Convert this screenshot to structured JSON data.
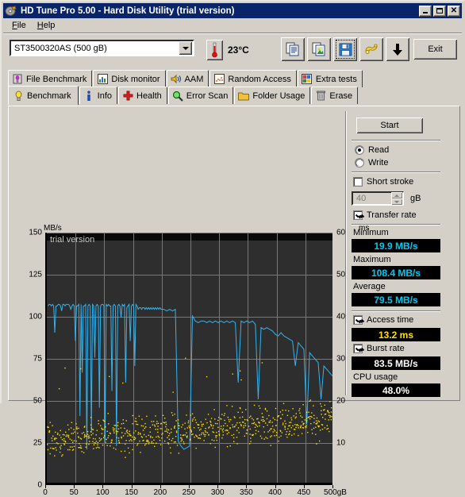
{
  "window": {
    "title": "HD Tune Pro 5.00 - Hard Disk Utility (trial version)",
    "icon": "hdtune-app-icon",
    "minimize_label": "_",
    "maximize_label": "□",
    "close_label": "✕"
  },
  "menu": {
    "items": [
      {
        "label": "File",
        "accel": "F"
      },
      {
        "label": "Help",
        "accel": "H"
      }
    ]
  },
  "toolbar": {
    "drive_selected": "ST3500320AS (500 gB)",
    "temperature": "23°C",
    "thermometer_icon": "thermometer-icon",
    "buttons": [
      {
        "name": "copy-text-button",
        "icon": "copy-text-icon"
      },
      {
        "name": "copy-image-button",
        "icon": "copy-image-icon"
      },
      {
        "name": "save-button",
        "icon": "floppy-save-icon",
        "focused": true
      },
      {
        "name": "options-button",
        "icon": "gear-options-icon"
      },
      {
        "name": "download-button",
        "icon": "arrow-down-icon"
      }
    ],
    "exit_label": "Exit"
  },
  "tabs": {
    "row1": [
      {
        "label": "File Benchmark",
        "icon": "bulb-purple-icon",
        "active": false
      },
      {
        "label": "Disk monitor",
        "icon": "bar-chart-icon",
        "active": false
      },
      {
        "label": "AAM",
        "icon": "speaker-icon",
        "active": false
      },
      {
        "label": "Random Access",
        "icon": "scatter-icon",
        "active": false
      },
      {
        "label": "Extra tests",
        "icon": "grid-chart-icon",
        "active": false
      }
    ],
    "row2": [
      {
        "label": "Benchmark",
        "icon": "bulb-yellow-icon",
        "active": true
      },
      {
        "label": "Info",
        "icon": "info-icon",
        "active": false
      },
      {
        "label": "Health",
        "icon": "red-cross-icon",
        "active": false
      },
      {
        "label": "Error Scan",
        "icon": "magnifier-icon",
        "active": false
      },
      {
        "label": "Folder Usage",
        "icon": "folder-icon",
        "active": false
      },
      {
        "label": "Erase",
        "icon": "trash-icon",
        "active": false
      }
    ]
  },
  "results": {
    "start_label": "Start",
    "mode_read": "Read",
    "mode_write": "Write",
    "mode_selected": "Read",
    "short_stroke_label": "Short stroke",
    "short_stroke_checked": false,
    "short_stroke_value": "40",
    "short_stroke_unit": "gB",
    "transfer_rate_label": "Transfer rate",
    "transfer_rate_checked": true,
    "minimum_label": "Minimum",
    "minimum_value": "19.9 MB/s",
    "maximum_label": "Maximum",
    "maximum_value": "108.4 MB/s",
    "average_label": "Average",
    "average_value": "79.5 MB/s",
    "access_time_label": "Access time",
    "access_time_checked": true,
    "access_time_value": "13.2 ms",
    "burst_rate_label": "Burst rate",
    "burst_rate_checked": true,
    "burst_rate_value": "83.5 MB/s",
    "cpu_usage_label": "CPU usage",
    "cpu_usage_value": "48.0%"
  },
  "colors": {
    "transfer_line": "#32b4f0",
    "access_dots": "#ffe000",
    "plot_bg": "#2e2e2e",
    "grid": "#787878",
    "lcd_bg": "#000000",
    "lcd_cyan": "#00c8f0",
    "lcd_yellow": "#ffe000",
    "lcd_white": "#ffffff",
    "titlebar": "#0a246a",
    "face": "#d4d0c8"
  },
  "chart_data": {
    "type": "line",
    "title": "",
    "watermark": "trial version",
    "xlabel": "",
    "ylabel": "MB/s",
    "ylabel_right": "ms",
    "xlim": [
      0,
      500
    ],
    "ylim": [
      0,
      150
    ],
    "ylim_right": [
      0,
      60
    ],
    "grid": true,
    "xticks": [
      0,
      50,
      100,
      150,
      200,
      250,
      300,
      350,
      400,
      450,
      500
    ],
    "xticklabels": [
      "0",
      "50",
      "100",
      "150",
      "200",
      "250",
      "300",
      "350",
      "400",
      "450",
      "500gB"
    ],
    "yticks": [
      0,
      25,
      50,
      75,
      100,
      125,
      150
    ],
    "yticklabels": [
      "0",
      "25",
      "50",
      "75",
      "100",
      "125",
      "150"
    ],
    "yticks_right": [
      10,
      20,
      30,
      40,
      50,
      60
    ],
    "yticklabels_right": [
      "10",
      "20",
      "30",
      "40",
      "50",
      "60"
    ],
    "legend": "none",
    "series": [
      {
        "name": "Transfer rate",
        "color": "#32b4f0",
        "axis": "left",
        "unit": "MB/s",
        "x": [
          2,
          4,
          6,
          8,
          10,
          12,
          14,
          16,
          18,
          20,
          22,
          24,
          26,
          28,
          30,
          32,
          34,
          36,
          38,
          40,
          42,
          44,
          46,
          48,
          50,
          52,
          54,
          56,
          58,
          60,
          62,
          64,
          66,
          68,
          70,
          72,
          74,
          76,
          78,
          80,
          82,
          84,
          86,
          88,
          90,
          92,
          94,
          96,
          98,
          100,
          102,
          104,
          106,
          108,
          110,
          112,
          114,
          116,
          118,
          120,
          122,
          124,
          126,
          128,
          130,
          132,
          134,
          136,
          138,
          140,
          142,
          144,
          146,
          148,
          150,
          152,
          154,
          156,
          158,
          160,
          162,
          164,
          166,
          168,
          170,
          172,
          174,
          176,
          178,
          180,
          182,
          184,
          186,
          188,
          190,
          192,
          194,
          196,
          198,
          200,
          205,
          210,
          215,
          220,
          225,
          230,
          235,
          240,
          245,
          250,
          255,
          260,
          265,
          270,
          275,
          280,
          285,
          290,
          295,
          300,
          305,
          310,
          315,
          320,
          325,
          330,
          335,
          340,
          345,
          350,
          355,
          360,
          365,
          370,
          375,
          380,
          385,
          390,
          395,
          400,
          405,
          410,
          415,
          420,
          425,
          430,
          435,
          440,
          445,
          450,
          455,
          460,
          465,
          470,
          475,
          480,
          485,
          490,
          495,
          500
        ],
        "y": [
          106,
          107,
          107,
          106,
          107,
          106,
          90,
          106,
          106,
          107,
          107,
          106,
          103,
          107,
          107,
          106,
          107,
          107,
          107,
          106,
          104,
          106,
          107,
          106,
          85,
          106,
          106,
          107,
          40,
          107,
          66,
          106,
          106,
          107,
          20,
          106,
          107,
          106,
          30,
          107,
          106,
          75,
          106,
          107,
          106,
          45,
          106,
          107,
          107,
          106,
          25,
          107,
          106,
          107,
          106,
          106,
          55,
          106,
          107,
          106,
          22,
          106,
          107,
          106,
          99,
          107,
          106,
          107,
          60,
          105,
          106,
          107,
          85,
          106,
          107,
          106,
          70,
          107,
          106,
          104,
          105,
          105,
          104,
          105,
          105,
          104,
          105,
          104,
          105,
          104,
          105,
          104,
          105,
          104,
          105,
          104,
          105,
          104,
          105,
          104,
          104,
          103,
          104,
          103,
          104,
          25,
          22,
          20,
          21,
          22,
          100,
          97,
          96,
          97,
          97,
          96,
          97,
          96,
          97,
          96,
          97,
          96,
          97,
          96,
          97,
          96,
          60,
          97,
          96,
          97,
          96,
          97,
          95,
          50,
          93,
          92,
          93,
          92,
          91,
          89,
          88,
          90,
          88,
          87,
          86,
          85,
          70,
          84,
          82,
          80,
          35,
          78,
          76,
          74,
          72,
          50,
          70,
          68,
          66,
          64,
          62,
          60,
          45,
          58
        ],
        "note": "Transfer rate curve: starts ~106 MB/s with deep drops, steps down to ~97 MB/s near 300 gB, declines to ~20-60 MB/s near 500 gB; minimum 19.9, maximum 108.4, average 79.5"
      },
      {
        "name": "Access time",
        "color": "#ffe000",
        "axis": "right",
        "unit": "ms",
        "style": "scatter",
        "mean": 13.2,
        "spread": [
          4,
          22
        ],
        "note": "Yellow scatter of access time samples, average 13.2 ms, clustered 8-18 ms rising slightly across the drive, a few outliers up to ~30 ms"
      }
    ]
  }
}
